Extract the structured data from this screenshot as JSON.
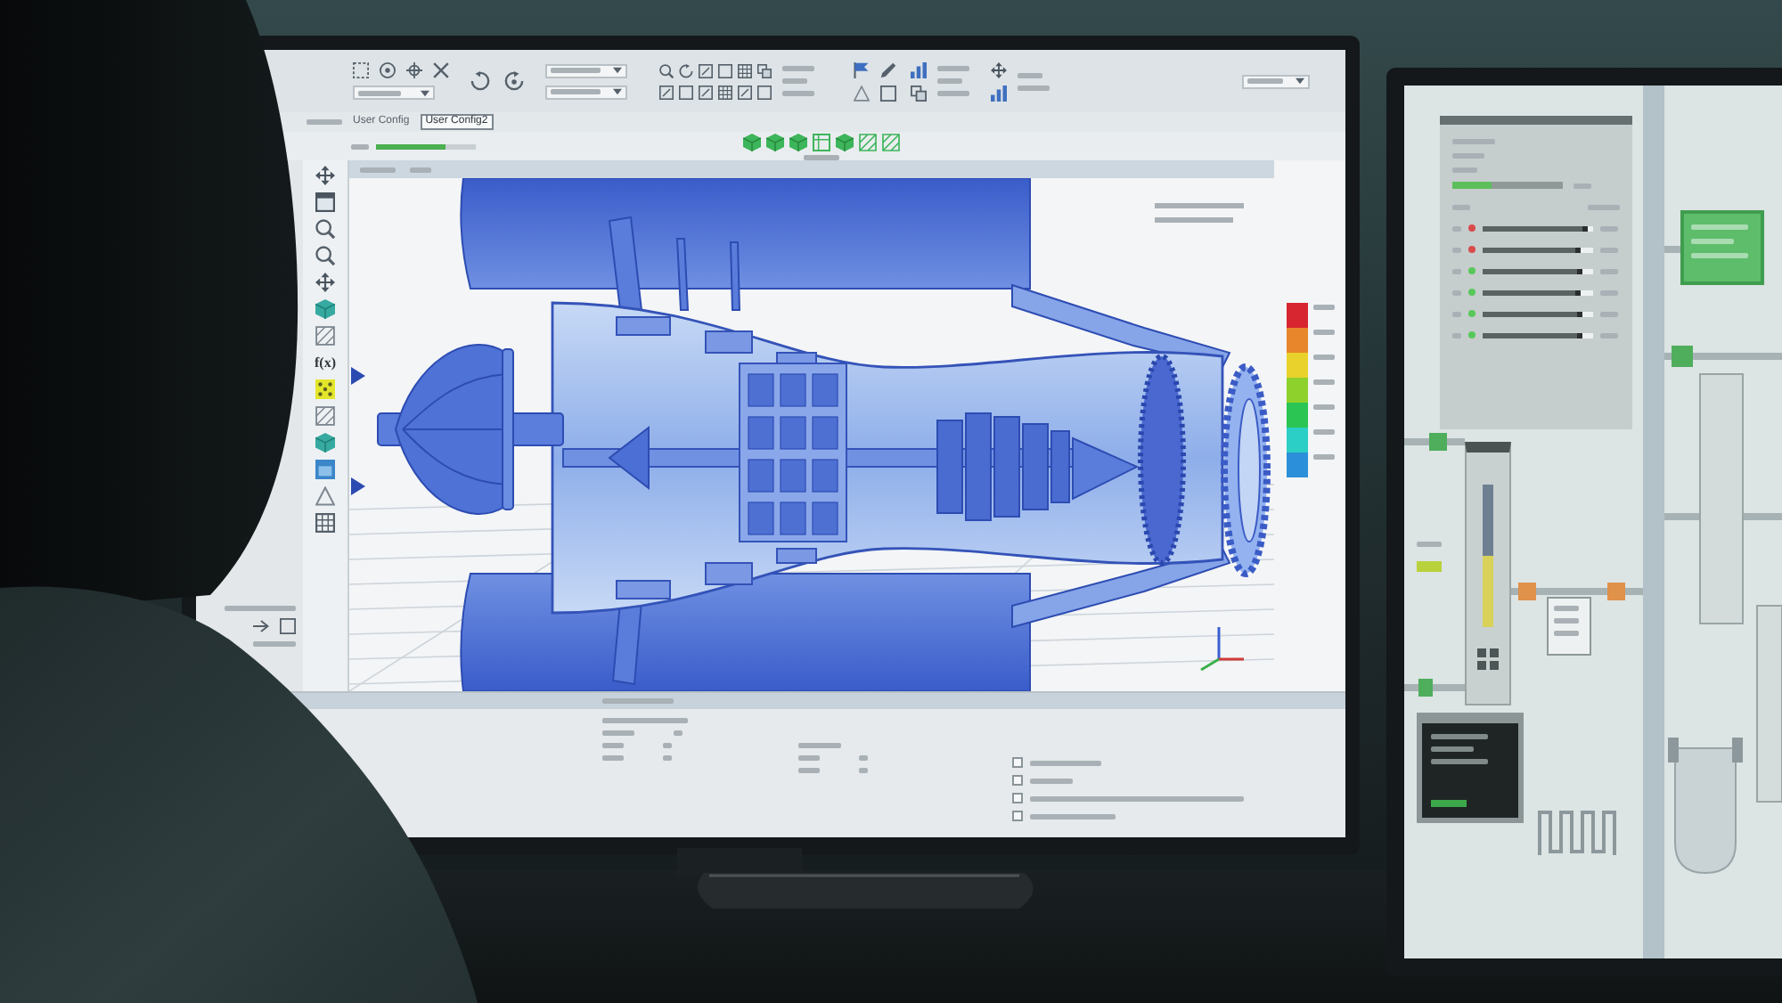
{
  "main_monitor": {
    "tabs": [
      {
        "label": "User Config",
        "selected": false
      },
      {
        "label": "User Config2",
        "selected": true
      }
    ],
    "zoom_bar": {
      "level": 0.7
    },
    "function_button": "f(x)",
    "color_scale": [
      {
        "color": "#d7262f"
      },
      {
        "color": "#e8862b"
      },
      {
        "color": "#e9d22c"
      },
      {
        "color": "#8ed12c"
      },
      {
        "color": "#2bc553"
      },
      {
        "color": "#2bcfc6"
      },
      {
        "color": "#2b90d9"
      }
    ]
  },
  "control_monitor": {
    "status_bar": {
      "level": 0.35
    },
    "channels": [
      {
        "color": "#d94a4a",
        "level": 0.95
      },
      {
        "color": "#d94a4a",
        "level": 0.88
      },
      {
        "color": "#58c85a",
        "level": 0.9
      },
      {
        "color": "#58c85a",
        "level": 0.88
      },
      {
        "color": "#58c85a",
        "level": 0.9
      },
      {
        "color": "#58c85a",
        "level": 0.9
      }
    ],
    "gauge": {
      "level": 0.5
    }
  }
}
